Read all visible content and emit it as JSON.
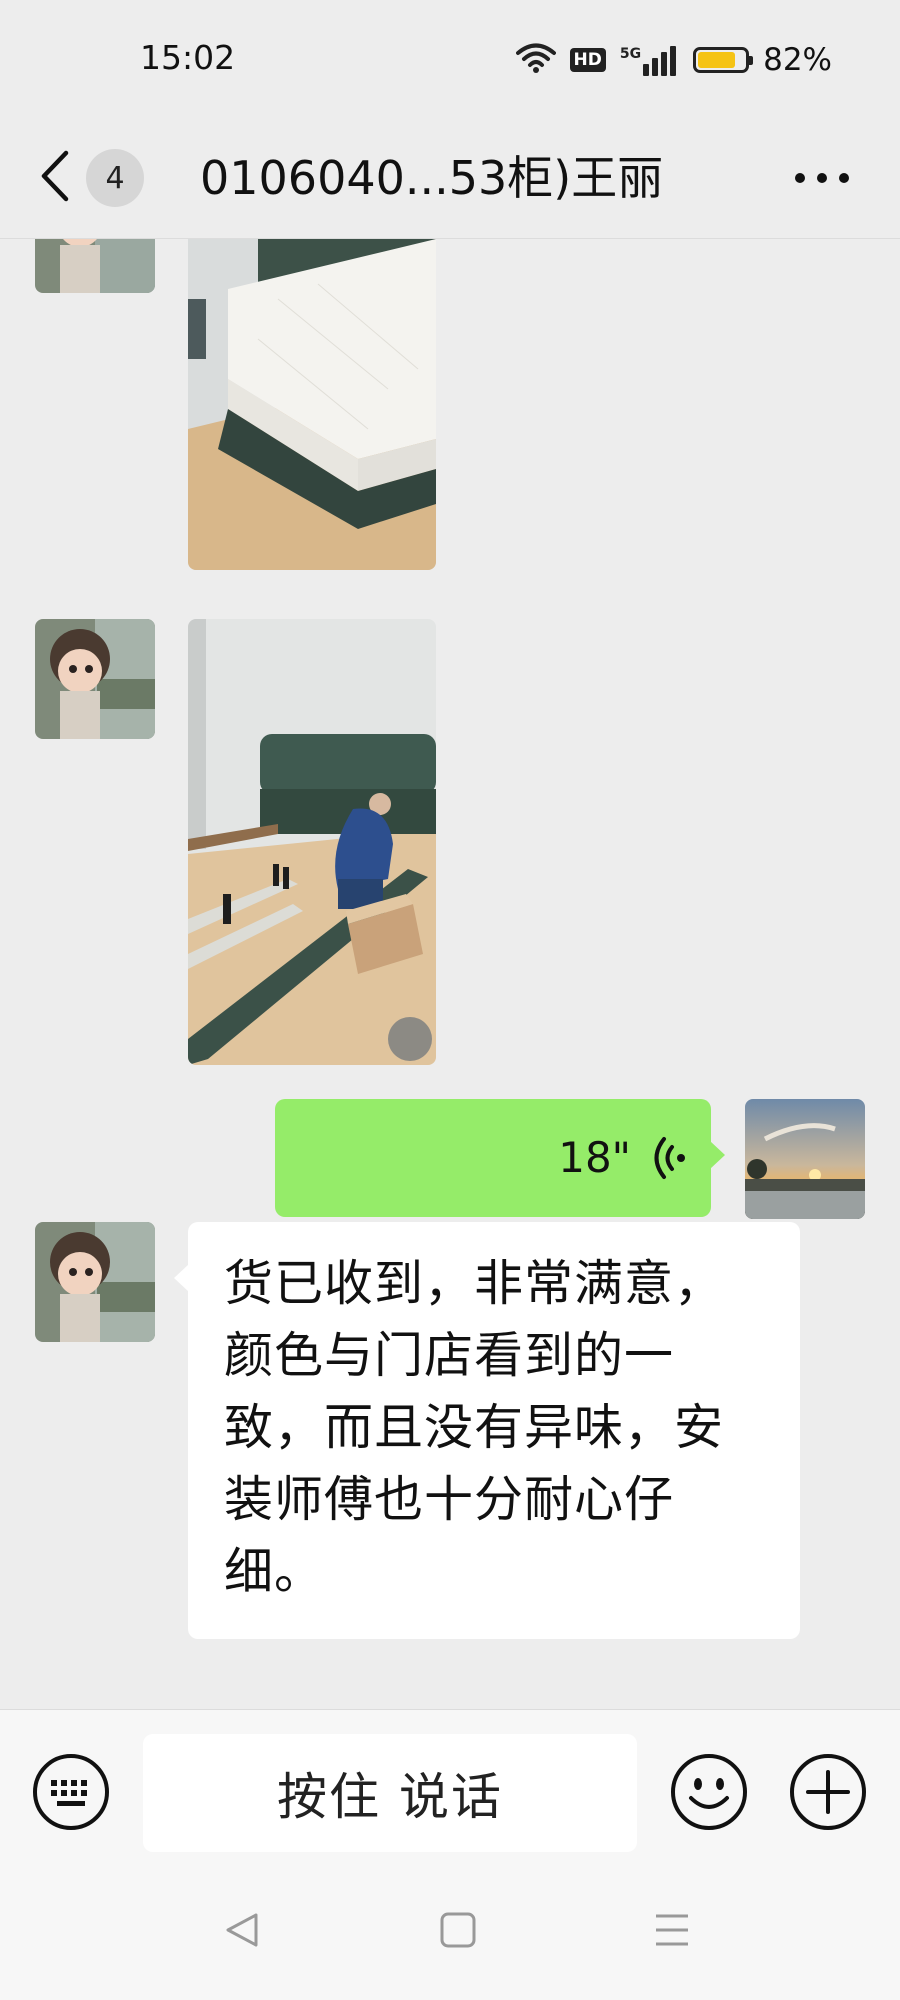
{
  "status_bar": {
    "time": "15:02",
    "hd_label": "HD",
    "network_label": "5G",
    "battery_percent": "82%",
    "battery_level": 0.82,
    "battery_color": "#f5c314",
    "icons": [
      "wifi-icon",
      "hd-icon",
      "5g-signal-icon",
      "battery-icon"
    ]
  },
  "header": {
    "back_icon": "chevron-left-icon",
    "unread_count": "4",
    "title": "0106040...53柜)王丽",
    "more_icon": "more-dots-icon"
  },
  "messages": [
    {
      "type": "image",
      "side": "left",
      "description_icon": "photo-mattress-bed"
    },
    {
      "type": "image",
      "side": "left",
      "description_icon": "photo-bed-installation"
    },
    {
      "type": "voice",
      "side": "right",
      "duration": "18\"",
      "bubble_color": "#95ec69"
    },
    {
      "type": "text",
      "side": "left",
      "text": "货已收到，非常满意，颜色与门店看到的一致，而且没有异味，安装师傅也十分耐心仔细。"
    }
  ],
  "input_bar": {
    "keyboard_icon": "keyboard-icon",
    "hold_to_talk_label": "按住 说话",
    "emoji_icon": "emoji-icon",
    "plus_icon": "plus-icon"
  },
  "nav_bar": {
    "icons": [
      "nav-back-icon",
      "nav-home-icon",
      "nav-menu-icon"
    ]
  }
}
